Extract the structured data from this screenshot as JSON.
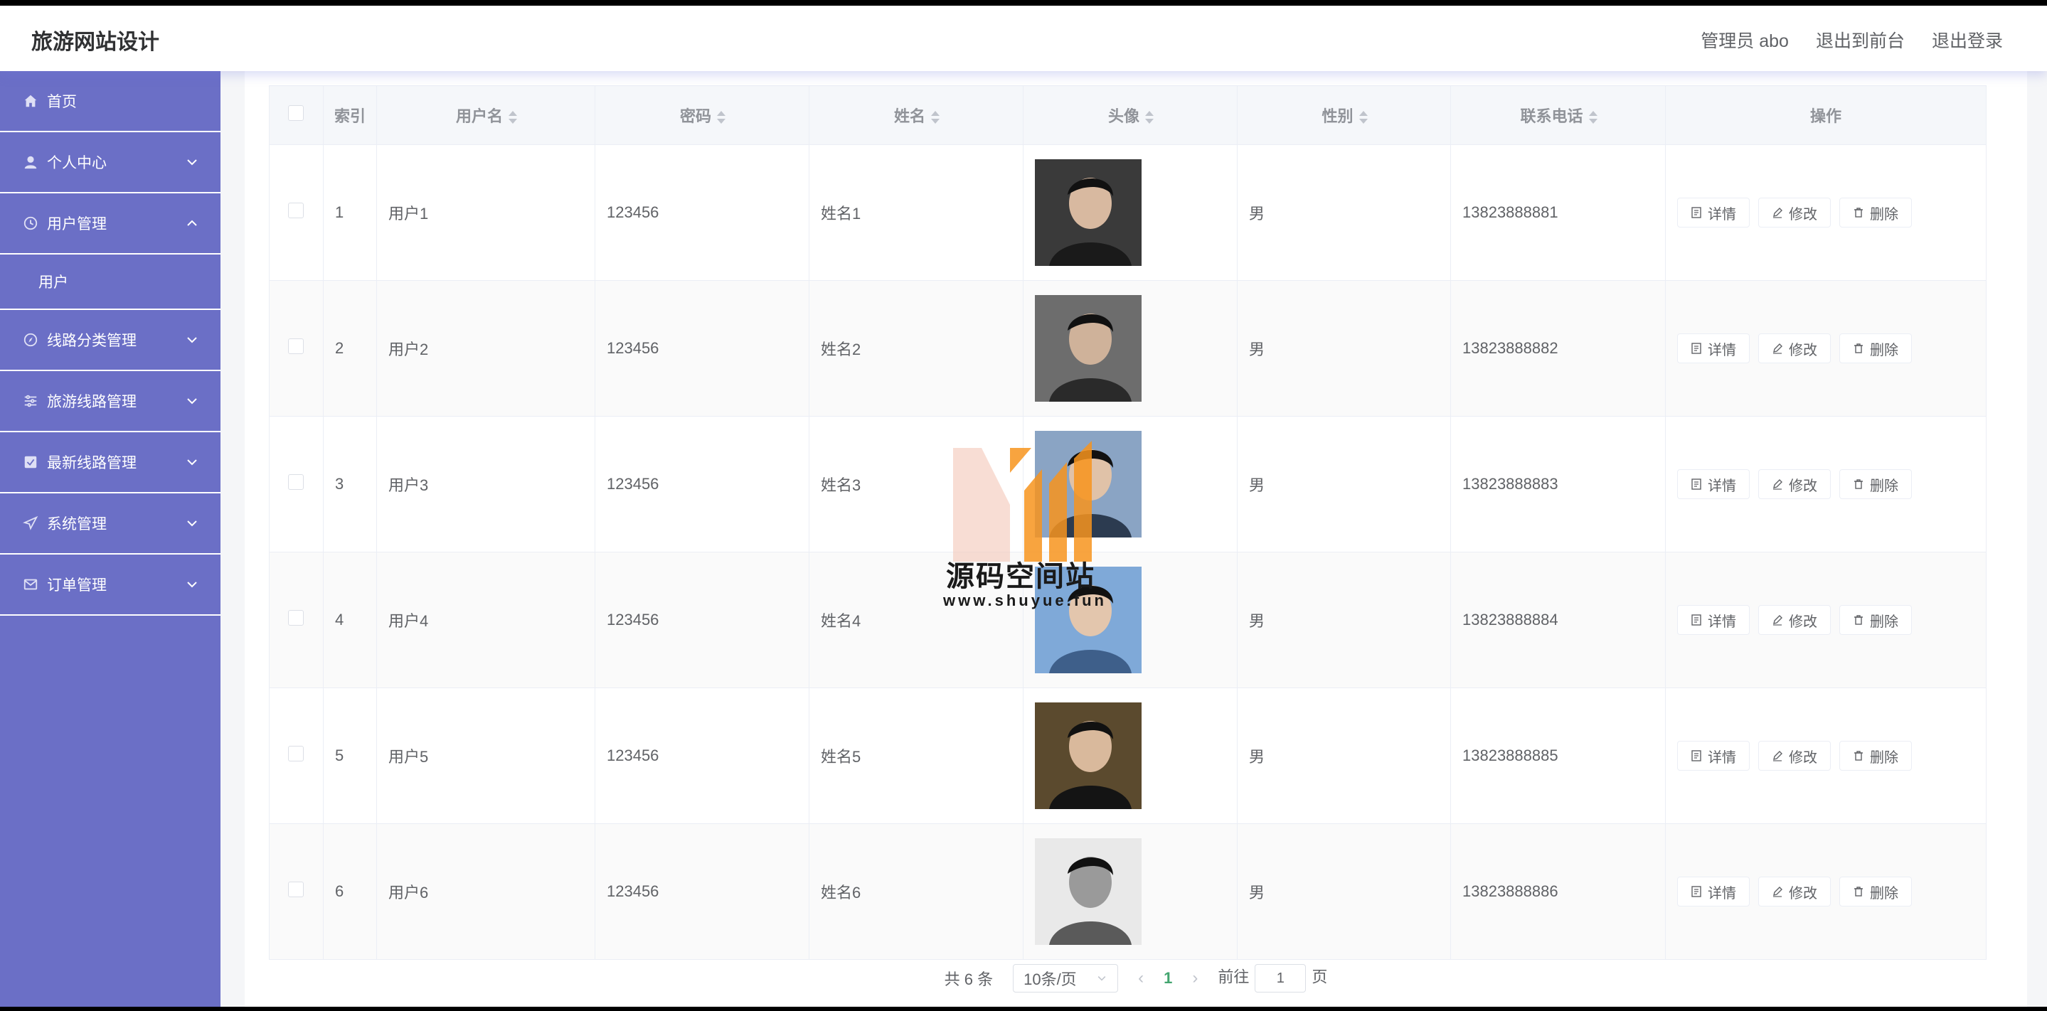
{
  "header": {
    "title": "旅游网站设计",
    "admin": "管理员 abo",
    "to_front": "退出到前台",
    "logout": "退出登录"
  },
  "sidebar": {
    "items": [
      {
        "label": "首页",
        "icon": "home-icon"
      },
      {
        "label": "个人中心",
        "icon": "user-icon"
      },
      {
        "label": "用户管理",
        "icon": "clock-icon",
        "expanded": true,
        "children": [
          {
            "label": "用户"
          }
        ]
      },
      {
        "label": "线路分类管理",
        "icon": "compass-icon"
      },
      {
        "label": "旅游线路管理",
        "icon": "sliders-icon"
      },
      {
        "label": "最新线路管理",
        "icon": "checkbox-icon"
      },
      {
        "label": "系统管理",
        "icon": "send-icon"
      },
      {
        "label": "订单管理",
        "icon": "mail-icon"
      }
    ]
  },
  "table": {
    "columns": [
      "索引",
      "用户名",
      "密码",
      "姓名",
      "头像",
      "性别",
      "联系电话",
      "操作"
    ],
    "rows": [
      {
        "index": "1",
        "username": "用户1",
        "password": "123456",
        "name": "姓名1",
        "gender": "男",
        "phone": "13823888881"
      },
      {
        "index": "2",
        "username": "用户2",
        "password": "123456",
        "name": "姓名2",
        "gender": "男",
        "phone": "13823888882"
      },
      {
        "index": "3",
        "username": "用户3",
        "password": "123456",
        "name": "姓名3",
        "gender": "男",
        "phone": "13823888883"
      },
      {
        "index": "4",
        "username": "用户4",
        "password": "123456",
        "name": "姓名4",
        "gender": "男",
        "phone": "13823888884"
      },
      {
        "index": "5",
        "username": "用户5",
        "password": "123456",
        "name": "姓名5",
        "gender": "男",
        "phone": "13823888885"
      },
      {
        "index": "6",
        "username": "用户6",
        "password": "123456",
        "name": "姓名6",
        "gender": "男",
        "phone": "13823888886"
      }
    ],
    "actions": {
      "detail": "详情",
      "edit": "修改",
      "delete": "删除"
    }
  },
  "pagination": {
    "total": "共 6 条",
    "page_size": "10条/页",
    "current_page": "1",
    "goto_prefix": "前往",
    "goto_value": "1",
    "goto_suffix": "页"
  },
  "watermark": {
    "title": "源码空间站",
    "url": "www.shuyue.fun"
  },
  "colors": {
    "sidebar": "#6b6fc6",
    "accent": "#43a56f",
    "watermark_orange": "#f7941d"
  }
}
